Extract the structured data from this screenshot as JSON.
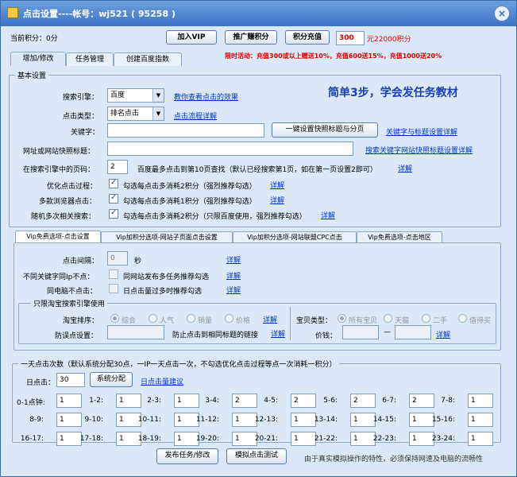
{
  "window": {
    "title": "点击设置----帐号：wj521 ( 95258 )",
    "close": "×"
  },
  "top": {
    "points_label": "当前积分：0分",
    "vip_btn": "加入VIP",
    "promo_btn": "推广赚积分",
    "recharge_btn": "积分充值",
    "recharge_value": "300",
    "recharge_result": "元22000积分",
    "promo_text": "限时活动：充值300或以上赠送10%，充值600送15%，充值1000送20%"
  },
  "tabs": [
    "增加/修改",
    "任务管理",
    "创建百度指数"
  ],
  "basic": {
    "legend": "基本设置",
    "headline": "简单3步，学会发任务教材",
    "engine_label": "搜索引擎：",
    "engine_value": "百度",
    "engine_link": "教你查看点击的效果",
    "clicktype_label": "点击类型：",
    "clicktype_value": "排名点击",
    "clicktype_link": "点击流程详解",
    "keyword_label": "关键字：",
    "keyword_value": "",
    "keyword_btn": "一键设置快照标题与分页",
    "keyword_link": "关键字与标题设置详解",
    "url_label": "网址或网站快照标题：",
    "url_value": "",
    "url_link": "搜索关键字网站快照标题设置详解",
    "page_label": "在搜索引擎中的页码：",
    "page_value": "2",
    "page_hint": "百度最多点击到第10页查找（默认已经搜索第1页，如在第一页设置2即可）",
    "page_link": "详解",
    "opt_label": "优化点击过程：",
    "opt_text": "勾选每点击多消耗2积分（强烈推荐勾选）",
    "opt_link": "详解",
    "multi_label": "多款浏览器点击：",
    "multi_text": "勾选每点击多消耗1积分（强烈推荐勾选）",
    "multi_link": "详解",
    "random_label": "随机多次相关搜索：",
    "random_text": "勾选每点击多消耗2积分（只限百度使用，强烈推荐勾选）",
    "random_link": "详解"
  },
  "subtabs": [
    "Vip免费选项-点击设置",
    "Vip加积分选项-网站子页面点击设置",
    "Vip加积分选项-网站联盟CPC点击",
    "Vip免费选项-点击地区"
  ],
  "vip": {
    "interval_label": "点击间隔：",
    "interval_value": "0",
    "interval_unit": "秒",
    "interval_link": "详解",
    "ip_label": "不同关键字同Ip不点：",
    "ip_text": "同网站发布多任务推荐勾选",
    "ip_link": "详解",
    "pc_label": "同电脑不点击：",
    "pc_text": "日点击量过多时推荐勾选",
    "pc_link": "详解",
    "taobao_legend": "只限淘宝搜索引擎使用",
    "sort_label": "淘宝排序：",
    "sort_options": [
      "综合",
      "人气",
      "销量",
      "价格"
    ],
    "sort_link": "详解",
    "anti_label": "防误点设置：",
    "anti_text": "防止点击到相同标题的链接",
    "anti_link": "详解",
    "type_label": "宝贝类型：",
    "type_options": [
      "所有宝贝",
      "天猫",
      "二手",
      "值得买"
    ],
    "price_label": "价钱：",
    "price_dash": "—",
    "price_link": "详解"
  },
  "daily": {
    "legend": "一天点击次数（默认系统分配30点，一IP一天点击一次，不勾选优化点击过程等点一次消耗一积分）",
    "day_label": "日点击：",
    "day_value": "30",
    "alloc_btn": "系统分配",
    "advice_link": "日点击量建议",
    "hours": [
      {
        "label": "0-1点钟:",
        "value": "1"
      },
      {
        "label": "1-2:",
        "value": "1"
      },
      {
        "label": "2-3:",
        "value": "1"
      },
      {
        "label": "3-4:",
        "value": "2"
      },
      {
        "label": "4-5:",
        "value": "2"
      },
      {
        "label": "5-6:",
        "value": "2"
      },
      {
        "label": "6-7:",
        "value": "2"
      },
      {
        "label": "7-8:",
        "value": "1"
      },
      {
        "label": "8-9:",
        "value": "1"
      },
      {
        "label": "9-10:",
        "value": "1"
      },
      {
        "label": "10-11:",
        "value": "1"
      },
      {
        "label": "11-12:",
        "value": "1"
      },
      {
        "label": "12-13:",
        "value": "1"
      },
      {
        "label": "13-14:",
        "value": "1"
      },
      {
        "label": "14-15:",
        "value": "1"
      },
      {
        "label": "15-16:",
        "value": "1"
      },
      {
        "label": "16-17:",
        "value": "1"
      },
      {
        "label": "17-18:",
        "value": "1"
      },
      {
        "label": "18-19:",
        "value": "1"
      },
      {
        "label": "19-20:",
        "value": "1"
      },
      {
        "label": "20-21:",
        "value": "1"
      },
      {
        "label": "21-22:",
        "value": "1"
      },
      {
        "label": "22-23:",
        "value": "1"
      },
      {
        "label": "23-24:",
        "value": "1"
      }
    ]
  },
  "bottom": {
    "publish_btn": "发布任务/修改",
    "simulate_btn": "模拟点击测试",
    "note": "由于真实模拟操作的特性，必须保持网速及电脑的流畅性"
  }
}
